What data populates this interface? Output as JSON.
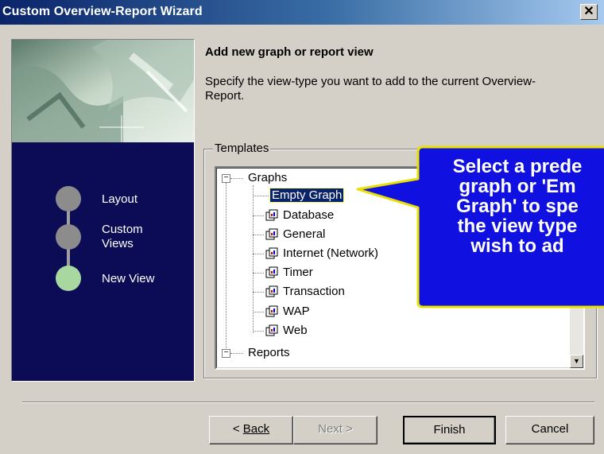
{
  "window": {
    "title": "Custom Overview-Report Wizard",
    "close_label": "✕"
  },
  "steps": [
    {
      "label": "Layout",
      "state": "done"
    },
    {
      "label": "Custom Views",
      "state": "done"
    },
    {
      "label": "New View",
      "state": "current"
    }
  ],
  "page": {
    "heading": "Add new graph or report view",
    "description": "Specify the view-type you want to add to the current Overview-Report.",
    "group_label": "Templates"
  },
  "tree": {
    "graphs_label": "Graphs",
    "graph_items": [
      "Empty Graph",
      "Database",
      "General",
      "Internet (Network)",
      "Timer",
      "Transaction",
      "WAP",
      "Web"
    ],
    "selected": "Empty Graph",
    "reports_label": "Reports",
    "expander_symbol": "−"
  },
  "callout": {
    "text": "Select a predefined graph or 'Empty Graph' to specify the view type you wish to add",
    "lines": [
      "Select a prede",
      "graph or 'Em",
      "Graph' to spe",
      "the view type",
      "wish to ad"
    ],
    "bg_color": "#1010e0",
    "border_color": "#e8e000"
  },
  "buttons": {
    "back": "Back",
    "next": "Next",
    "finish": "Finish",
    "cancel": "Cancel"
  }
}
